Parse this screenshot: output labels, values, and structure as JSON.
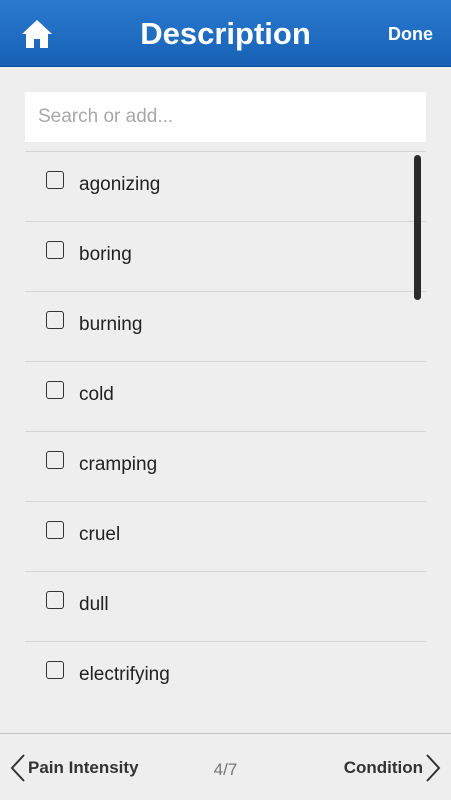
{
  "header": {
    "title": "Description",
    "done_label": "Done",
    "icon": "home-icon",
    "color": "#1f6fc4"
  },
  "search": {
    "placeholder": "Search or add...",
    "value": ""
  },
  "list": {
    "items": [
      {
        "label": "agonizing",
        "checked": false
      },
      {
        "label": "boring",
        "checked": false
      },
      {
        "label": "burning",
        "checked": false
      },
      {
        "label": "cold",
        "checked": false
      },
      {
        "label": "cramping",
        "checked": false
      },
      {
        "label": "cruel",
        "checked": false
      },
      {
        "label": "dull",
        "checked": false
      },
      {
        "label": "electrifying",
        "checked": false
      }
    ]
  },
  "footer": {
    "prev_label": "Pain Intensity",
    "page": "4/7",
    "next_label": "Condition",
    "prev_icon": "chevron-left-icon",
    "next_icon": "chevron-right-icon"
  }
}
